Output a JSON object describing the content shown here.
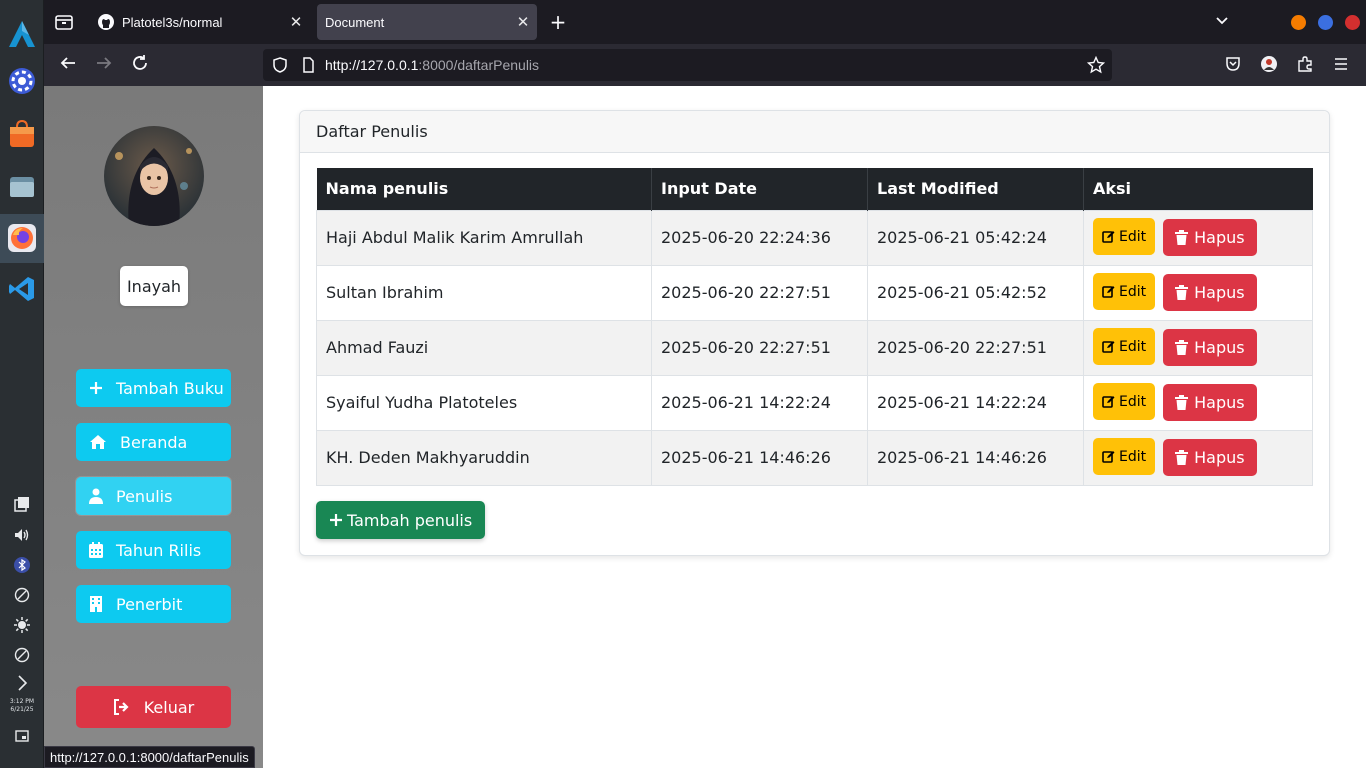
{
  "os": {
    "clock_time": "3:12 PM",
    "clock_date": "6/21/25"
  },
  "browser": {
    "tabs": [
      {
        "title": "Platotel3s/normal",
        "icon": "github-icon",
        "active": false
      },
      {
        "title": "Document",
        "active": true
      }
    ],
    "url_host": "http://127.0.0.1",
    "url_path": ":8000/daftarPenulis",
    "status_url": "http://127.0.0.1:8000/daftarPenulis",
    "window_colors": [
      "#f57c00",
      "#3b6fe0",
      "#d32f2f"
    ]
  },
  "sidebar": {
    "username": "Inayah",
    "menu": [
      {
        "label": "Tambah Buku",
        "icon": "plus-icon"
      },
      {
        "label": "Beranda",
        "icon": "home-icon"
      },
      {
        "label": "Penulis",
        "icon": "user-icon"
      },
      {
        "label": "Tahun Rilis",
        "icon": "calendar-icon"
      },
      {
        "label": "Penerbit",
        "icon": "building-icon"
      }
    ],
    "logout_label": "Keluar"
  },
  "main": {
    "card_title": "Daftar Penulis",
    "columns": [
      "Nama penulis",
      "Input Date",
      "Last Modified",
      "Aksi"
    ],
    "rows": [
      {
        "name": "Haji Abdul Malik Karim Amrullah",
        "input_date": "2025-06-20 22:24:36",
        "last_modified": "2025-06-21 05:42:24"
      },
      {
        "name": "Sultan Ibrahim",
        "input_date": "2025-06-20 22:27:51",
        "last_modified": "2025-06-21 05:42:52"
      },
      {
        "name": "Ahmad Fauzi",
        "input_date": "2025-06-20 22:27:51",
        "last_modified": "2025-06-20 22:27:51"
      },
      {
        "name": "Syaiful Yudha Platoteles",
        "input_date": "2025-06-21 14:22:24",
        "last_modified": "2025-06-21 14:22:24"
      },
      {
        "name": "KH. Deden Makhyaruddin",
        "input_date": "2025-06-21 14:46:26",
        "last_modified": "2025-06-21 14:46:26"
      }
    ],
    "edit_label": "Edit",
    "delete_label": "Hapus",
    "add_label": "Tambah penulis"
  }
}
